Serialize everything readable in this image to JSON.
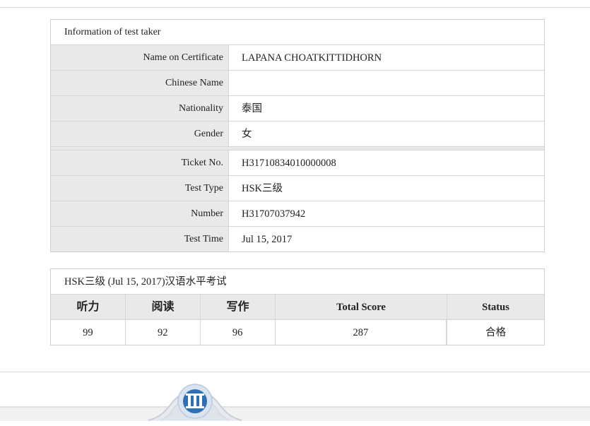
{
  "info": {
    "header": "Information of test taker",
    "rows": [
      {
        "label": "Name on Certificate",
        "value": "LAPANA CHOATKITTIDHORN"
      },
      {
        "label": "Chinese Name",
        "value": ""
      },
      {
        "label": "Nationality",
        "value": "泰国"
      },
      {
        "label": "Gender",
        "value": "女"
      }
    ],
    "exam_rows": [
      {
        "label": "Ticket No.",
        "value": "H31710834010000008"
      },
      {
        "label": "Test Type",
        "value": "HSK三级"
      },
      {
        "label": "Number",
        "value": "H31707037942"
      },
      {
        "label": "Test Time",
        "value": "Jul 15, 2017"
      }
    ]
  },
  "scores": {
    "header": "HSK三级 (Jul 15, 2017)汉语水平考试",
    "columns": [
      "听力",
      "阅读",
      "写作",
      "Total Score",
      "Status"
    ],
    "values": [
      "99",
      "92",
      "96",
      "287",
      "合格"
    ]
  },
  "footer": {
    "logo_icon": "hanban-logo-icon",
    "colors": {
      "logo_blue": "#2f6fb3",
      "band": "#f1f1f1"
    }
  }
}
